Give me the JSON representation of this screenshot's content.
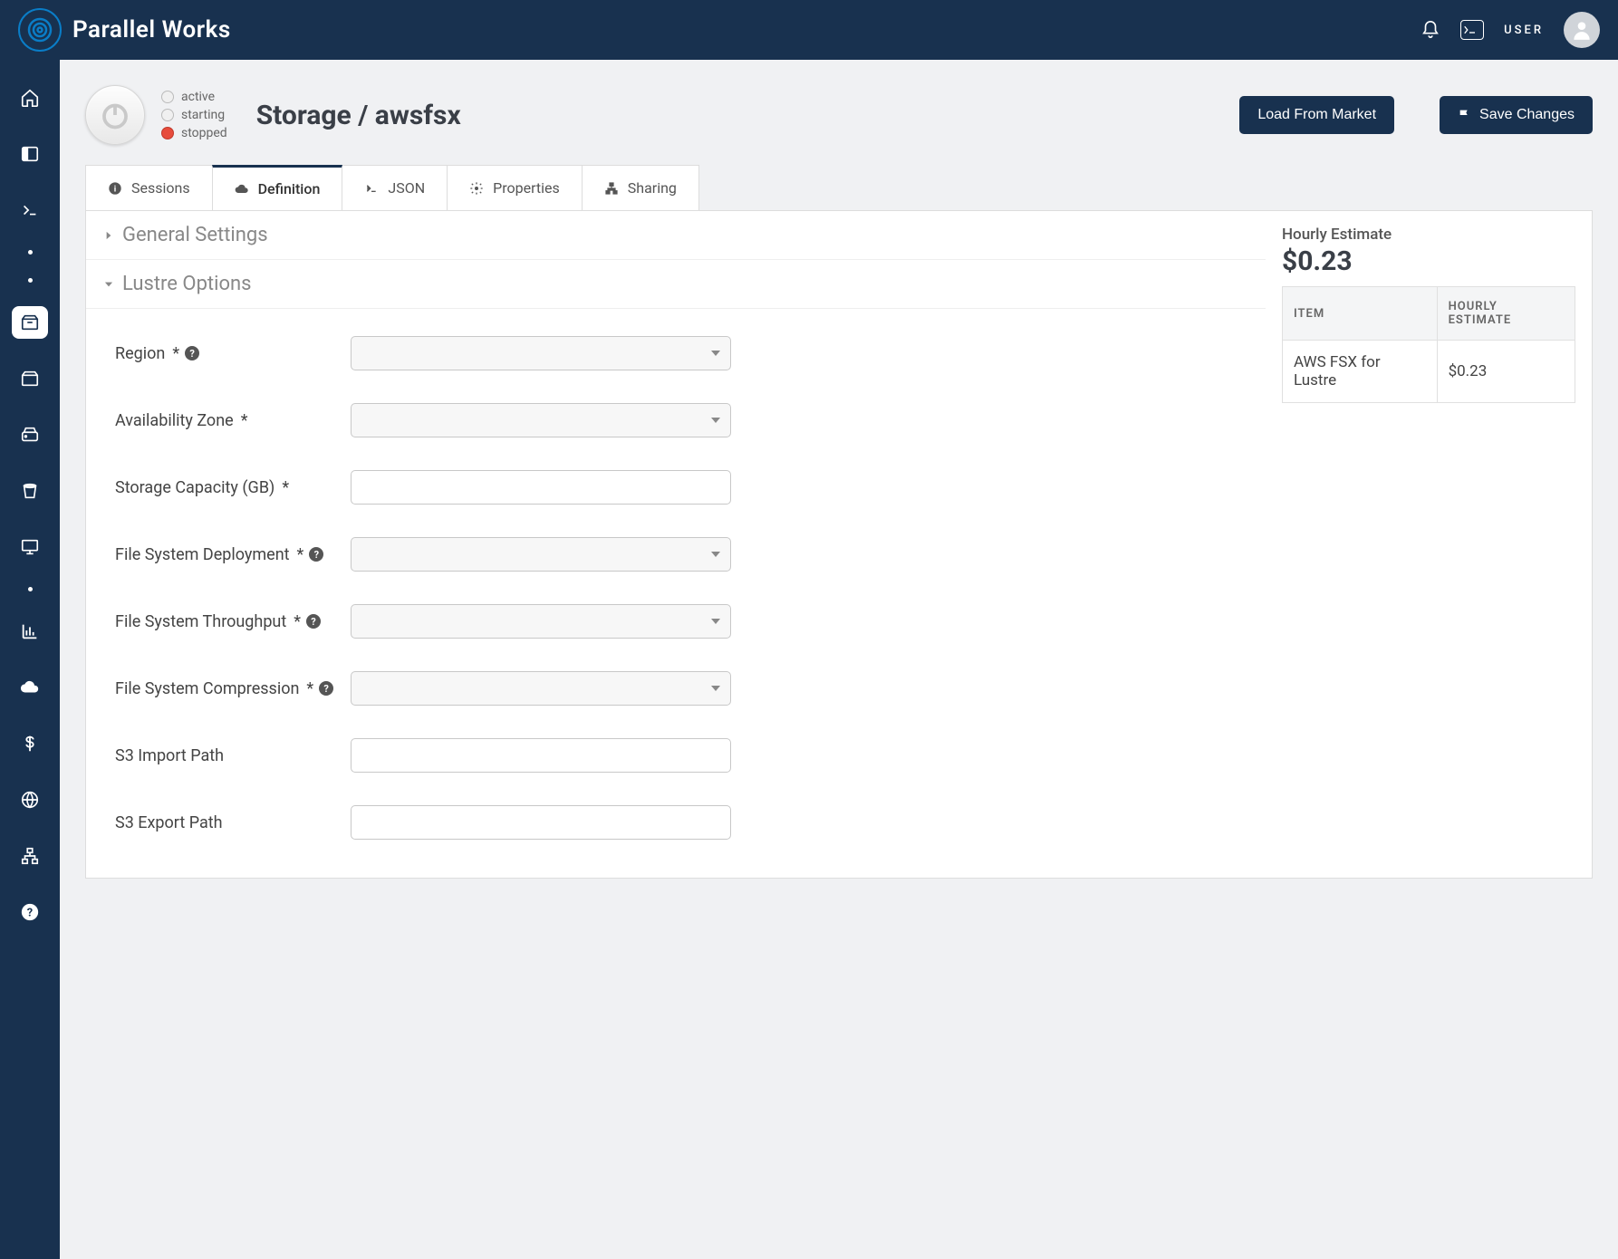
{
  "brand": "Parallel Works",
  "topbar": {
    "user_label": "USER"
  },
  "status": {
    "active": "active",
    "starting": "starting",
    "stopped": "stopped"
  },
  "page": {
    "title": "Storage / awsfsx"
  },
  "buttons": {
    "load_market": "Load From Market",
    "save_changes": "Save Changes"
  },
  "tabs": {
    "sessions": "Sessions",
    "definition": "Definition",
    "json": "JSON",
    "properties": "Properties",
    "sharing": "Sharing"
  },
  "sections": {
    "general": "General Settings",
    "lustre": "Lustre Options"
  },
  "fields": {
    "region": "Region",
    "az": "Availability Zone",
    "capacity": "Storage Capacity (GB)",
    "deployment": "File System Deployment",
    "throughput": "File System Throughput",
    "compression": "File System Compression",
    "s3_import": "S3 Import Path",
    "s3_export": "S3 Export Path"
  },
  "estimate": {
    "label": "Hourly Estimate",
    "value": "$0.23",
    "col_item": "ITEM",
    "col_hourly": "HOURLY ESTIMATE",
    "row_item": "AWS FSX for Lustre",
    "row_val": "$0.23"
  }
}
